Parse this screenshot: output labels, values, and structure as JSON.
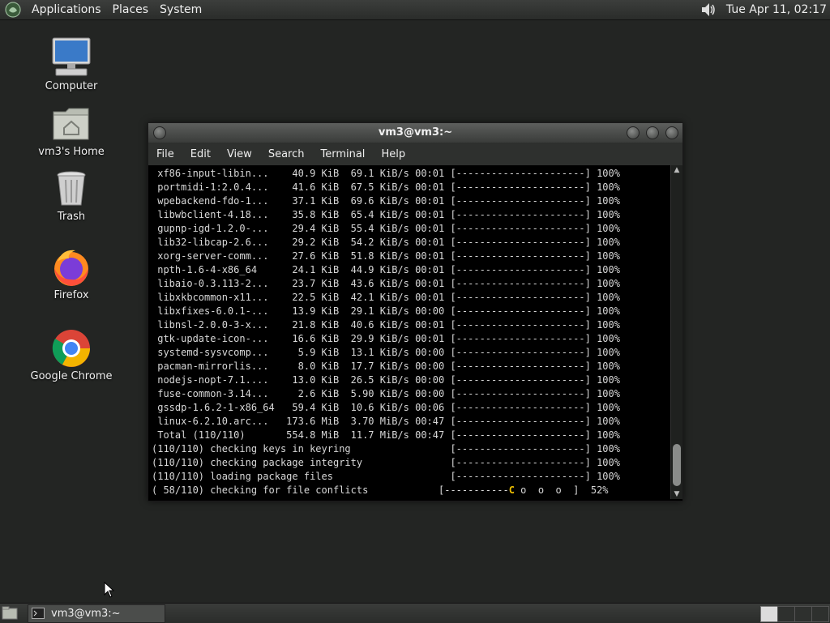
{
  "top_panel": {
    "menus": [
      "Applications",
      "Places",
      "System"
    ],
    "clock": "Tue Apr 11, 02:17",
    "icons": [
      "distro-logo-icon",
      "volume-icon"
    ]
  },
  "desktop": {
    "icons": [
      {
        "label": "Computer",
        "icon": "computer-icon"
      },
      {
        "label": "vm3's Home",
        "icon": "home-folder-icon"
      },
      {
        "label": "Trash",
        "icon": "trash-icon"
      },
      {
        "label": "Firefox",
        "icon": "firefox-icon"
      },
      {
        "label": "Google Chrome",
        "icon": "chrome-icon"
      }
    ]
  },
  "terminal": {
    "title": "vm3@vm3:~",
    "menu": [
      "File",
      "Edit",
      "View",
      "Search",
      "Terminal",
      "Help"
    ],
    "lines": [
      " xf86-input-libin...    40.9 KiB  69.1 KiB/s 00:01 [----------------------] 100%",
      " portmidi-1:2.0.4...    41.6 KiB  67.5 KiB/s 00:01 [----------------------] 100%",
      " wpebackend-fdo-1...    37.1 KiB  69.6 KiB/s 00:01 [----------------------] 100%",
      " libwbclient-4.18...    35.8 KiB  65.4 KiB/s 00:01 [----------------------] 100%",
      " gupnp-igd-1.2.0-...    29.4 KiB  55.4 KiB/s 00:01 [----------------------] 100%",
      " lib32-libcap-2.6...    29.2 KiB  54.2 KiB/s 00:01 [----------------------] 100%",
      " xorg-server-comm...    27.6 KiB  51.8 KiB/s 00:01 [----------------------] 100%",
      " npth-1.6-4-x86_64      24.1 KiB  44.9 KiB/s 00:01 [----------------------] 100%",
      " libaio-0.3.113-2...    23.7 KiB  43.6 KiB/s 00:01 [----------------------] 100%",
      " libxkbcommon-x11...    22.5 KiB  42.1 KiB/s 00:01 [----------------------] 100%",
      " libxfixes-6.0.1-...    13.9 KiB  29.1 KiB/s 00:00 [----------------------] 100%",
      " libnsl-2.0.0-3-x...    21.8 KiB  40.6 KiB/s 00:01 [----------------------] 100%",
      " gtk-update-icon-...    16.6 KiB  29.9 KiB/s 00:01 [----------------------] 100%",
      " systemd-sysvcomp...     5.9 KiB  13.1 KiB/s 00:00 [----------------------] 100%",
      " pacman-mirrorlis...     8.0 KiB  17.7 KiB/s 00:00 [----------------------] 100%",
      " nodejs-nopt-7.1....    13.0 KiB  26.5 KiB/s 00:00 [----------------------] 100%",
      " fuse-common-3.14...     2.6 KiB  5.90 KiB/s 00:00 [----------------------] 100%",
      " gssdp-1.6.2-1-x86_64   59.4 KiB  10.6 KiB/s 00:06 [----------------------] 100%",
      " linux-6.2.10.arc...   173.6 MiB  3.70 MiB/s 00:47 [----------------------] 100%",
      " Total (110/110)       554.8 MiB  11.7 MiB/s 00:47 [----------------------] 100%",
      "(110/110) checking keys in keyring                 [----------------------] 100%",
      "(110/110) checking package integrity               [----------------------] 100%",
      "(110/110) loading package files                    [----------------------] 100%"
    ],
    "progress_line": {
      "prefix": "( 58/110) checking for file conflicts            [-----------",
      "pacman": "C",
      "suffix": " o  o  o  ]  52%"
    }
  },
  "bottom_panel": {
    "task": "vm3@vm3:~"
  }
}
